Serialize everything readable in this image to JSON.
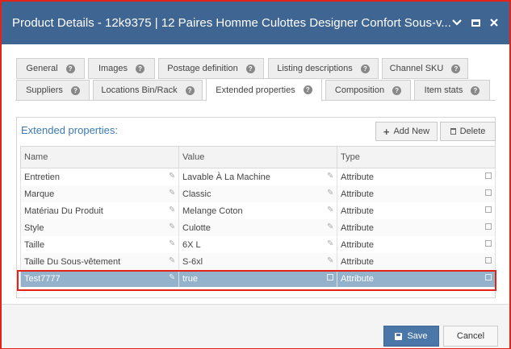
{
  "window": {
    "title": "Product Details - 12k9375 | 12 Paires Homme Culottes Designer Confort Sous-v...",
    "icons": [
      "chevron-down-icon",
      "maximize-icon",
      "close-icon"
    ]
  },
  "tabs_row1": [
    {
      "label": "General"
    },
    {
      "label": "Images"
    },
    {
      "label": "Postage definition"
    },
    {
      "label": "Listing descriptions"
    },
    {
      "label": "Channel SKU"
    }
  ],
  "tabs_row2": [
    {
      "label": "Suppliers"
    },
    {
      "label": "Locations Bin/Rack"
    },
    {
      "label": "Extended properties",
      "active": true
    },
    {
      "label": "Composition"
    },
    {
      "label": "Item stats"
    }
  ],
  "panel": {
    "title": "Extended properties:",
    "add_new_label": "Add New",
    "delete_label": "Delete"
  },
  "grid": {
    "columns": [
      "Name",
      "Value",
      "Type"
    ],
    "rows": [
      {
        "name": "Entretien",
        "value": "Lavable À La Machine",
        "type": "Attribute"
      },
      {
        "name": "Marque",
        "value": "Classic",
        "type": "Attribute"
      },
      {
        "name": "Matériau Du Produit",
        "value": "Melange Coton",
        "type": "Attribute"
      },
      {
        "name": "Style",
        "value": "Culotte",
        "type": "Attribute"
      },
      {
        "name": "Taille",
        "value": "6X L",
        "type": "Attribute"
      },
      {
        "name": "Taille Du Sous-vêtement",
        "value": "S-6xl",
        "type": "Attribute"
      },
      {
        "name": "Test7777",
        "value": "true",
        "type": "Attribute",
        "selected": true
      }
    ]
  },
  "footer": {
    "save_label": "Save",
    "cancel_label": "Cancel"
  },
  "colors": {
    "titlebar": "#3f6593",
    "selected_row": "#94b2cc",
    "highlight_border": "#e2231a",
    "save_button": "#4a76a8"
  }
}
